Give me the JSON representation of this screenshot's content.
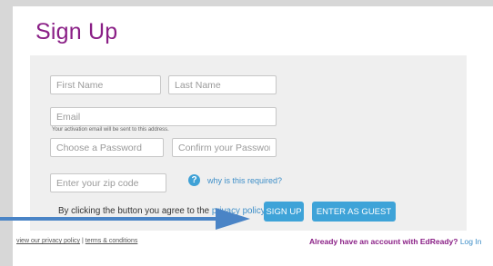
{
  "form": {
    "title": "Sign Up",
    "first_name_placeholder": "First Name",
    "last_name_placeholder": "Last Name",
    "email_placeholder": "Email",
    "email_hint": "Your activation email will be sent to this address.",
    "password_placeholder": "Choose a Password",
    "confirm_password_placeholder": "Confirm your Password",
    "zip_placeholder": "Enter your zip code",
    "help_icon_glyph": "?",
    "why_link": "why is this required?",
    "agree_text": "By clicking the button you agree to the",
    "privacy_link": "privacy policy"
  },
  "buttons": {
    "sign_up": "SIGN UP",
    "guest": "ENTER AS GUEST"
  },
  "footer": {
    "privacy_link": "view our privacy policy",
    "separator": "|",
    "terms_link": "terms & conditions",
    "account_question": "Already have an account with EdReady?",
    "login_link": "Log In"
  },
  "colors": {
    "brand_purple": "#8a1f86",
    "button_blue": "#3ea3d8",
    "link_blue": "#3f8fc8",
    "arrow_blue": "#4a84c6"
  },
  "icons": [
    "question-circle-icon",
    "arrow-right-icon"
  ]
}
